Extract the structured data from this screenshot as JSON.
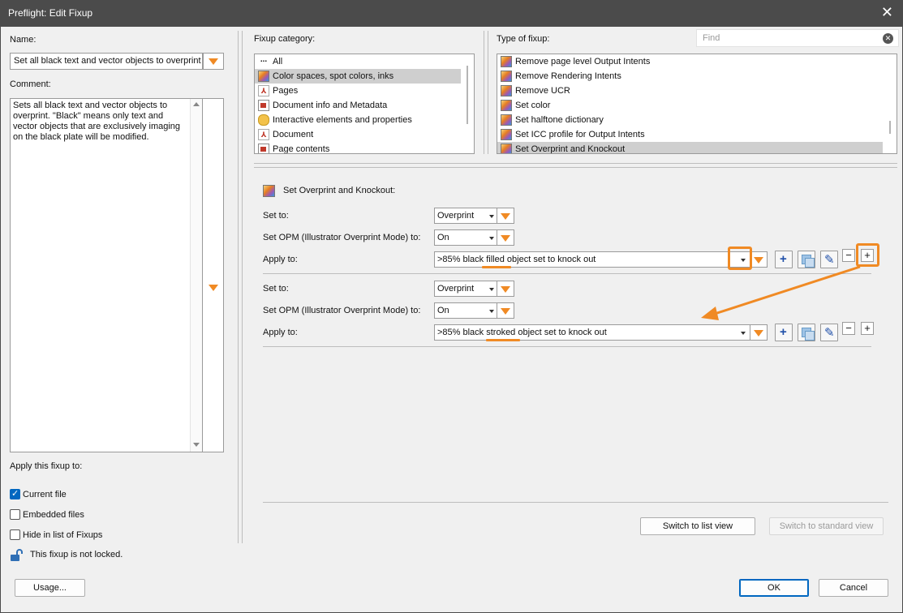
{
  "window": {
    "title": "Preflight: Edit Fixup",
    "close_glyph": "✕"
  },
  "left": {
    "name_label": "Name:",
    "name_value": "Set all black text and vector objects to overprint",
    "comment_label": "Comment:",
    "comment_text": "Sets all black text and vector objects to overprint. \"Black\" means only text and vector objects that are exclusively imaging on the black plate will be modified.",
    "apply_label": "Apply this fixup to:",
    "checkboxes": [
      {
        "label": "Current file",
        "checked": true
      },
      {
        "label": "Embedded files",
        "checked": false
      },
      {
        "label": "Hide in list of Fixups",
        "checked": false
      }
    ],
    "lock_text": "This fixup is not locked.",
    "usage_button": "Usage..."
  },
  "category": {
    "label": "Fixup category:",
    "items": [
      {
        "label": "All",
        "icon": "dots-icon"
      },
      {
        "label": "Color spaces, spot colors, inks",
        "icon": "color-spaces-icon",
        "selected": true
      },
      {
        "label": "Pages",
        "icon": "pdf-icon"
      },
      {
        "label": "Document info and Metadata",
        "icon": "document-info-icon"
      },
      {
        "label": "Interactive elements and properties",
        "icon": "comment-bubble-icon"
      },
      {
        "label": "Document",
        "icon": "pdf-icon"
      },
      {
        "label": "Page contents",
        "icon": "page-contents-icon"
      }
    ]
  },
  "type": {
    "label": "Type of fixup:",
    "find_placeholder": "Find",
    "items": [
      {
        "label": "Remove page level Output Intents"
      },
      {
        "label": "Remove Rendering Intents"
      },
      {
        "label": "Remove UCR"
      },
      {
        "label": "Set color"
      },
      {
        "label": "Set halftone dictionary"
      },
      {
        "label": "Set ICC profile for Output Intents"
      },
      {
        "label": "Set Overprint and Knockout",
        "selected": true
      }
    ]
  },
  "detail": {
    "heading": "Set Overprint and Knockout:",
    "groups": [
      {
        "set_to_label": "Set to:",
        "set_to_value": "Overprint",
        "opm_label": "Set OPM (Illustrator Overprint Mode) to:",
        "opm_value": "On",
        "apply_label": "Apply to:",
        "apply_value": ">85% black filled object set to knock out"
      },
      {
        "set_to_label": "Set to:",
        "set_to_value": "Overprint",
        "opm_label": "Set OPM (Illustrator Overprint Mode) to:",
        "opm_value": "On",
        "apply_label": "Apply to:",
        "apply_value": ">85% black stroked object set to knock out"
      }
    ],
    "minus_glyph": "−",
    "plus_glyph": "+",
    "switch_list": "Switch to list view",
    "switch_standard": "Switch to standard view"
  },
  "footer": {
    "ok": "OK",
    "cancel": "Cancel"
  },
  "colors": {
    "accent_orange": "#f08a24",
    "title_bar": "#4b4b4b",
    "primary_blue": "#0067c0"
  }
}
